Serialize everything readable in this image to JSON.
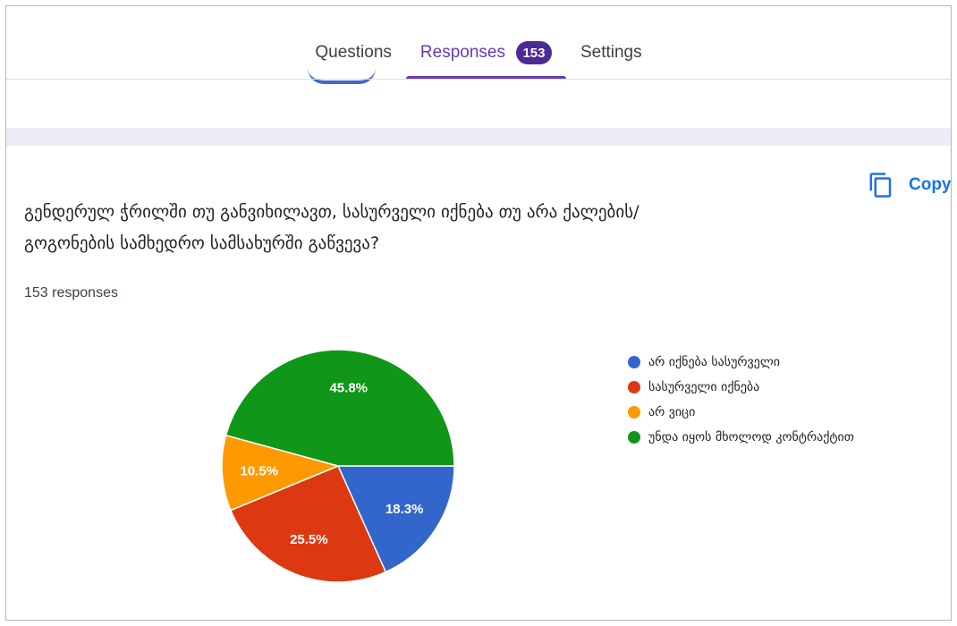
{
  "tabs": [
    {
      "label": "Questions",
      "active": false
    },
    {
      "label": "Responses",
      "active": true,
      "badge": "153"
    },
    {
      "label": "Settings",
      "active": false
    }
  ],
  "copy": {
    "label": "Copy",
    "icon": "copy-icon"
  },
  "question": {
    "line1": "გენდერულ ჭრილში თუ განვიხილავთ, სასურველი იქნება თუ არა ქალების/",
    "line2": "გოგონების სამხედრო სამსახურში გაწვევა?"
  },
  "responses_count": "153 responses",
  "colors": {
    "accent": "#673ab7",
    "blue": "#3366cc",
    "red": "#dc3912",
    "orange": "#ff9900",
    "green": "#109618"
  },
  "chart_data": {
    "type": "pie",
    "slices": [
      {
        "label": "არ იქნება სასურველი",
        "value": 18.3,
        "display": "18.3%",
        "color": "#3366cc"
      },
      {
        "label": "სასურველი იქნება",
        "value": 25.5,
        "display": "25.5%",
        "color": "#dc3912"
      },
      {
        "label": "არ ვიცი",
        "value": 10.5,
        "display": "10.5%",
        "color": "#ff9900"
      },
      {
        "label": "უნდა იყოს მხოლოდ კონტრაქტით",
        "value": 45.8,
        "display": "45.8%",
        "color": "#109618"
      }
    ],
    "legend_position": "right"
  }
}
